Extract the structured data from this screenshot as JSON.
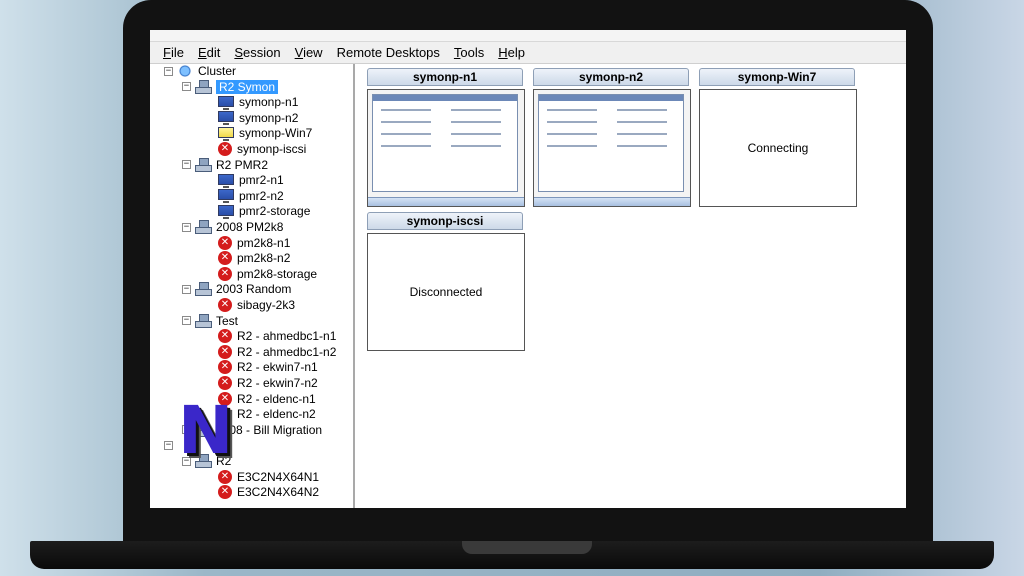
{
  "menu": [
    {
      "label": "File",
      "accel": "F"
    },
    {
      "label": "Edit",
      "accel": "E"
    },
    {
      "label": "Session",
      "accel": "S"
    },
    {
      "label": "View",
      "accel": "V"
    },
    {
      "label": "Remote Desktops",
      "accel": ""
    },
    {
      "label": "Tools",
      "accel": "T"
    },
    {
      "label": "Help",
      "accel": "H"
    }
  ],
  "tree": {
    "root": "Cluster",
    "groups": [
      {
        "label": "R2 Symon",
        "selected": true,
        "items": [
          {
            "label": "symonp-n1",
            "icon": "monitor-icon"
          },
          {
            "label": "symonp-n2",
            "icon": "monitor-icon"
          },
          {
            "label": "symonp-Win7",
            "icon": "monitor-yellow-icon"
          },
          {
            "label": "symonp-iscsi",
            "icon": "error-icon"
          }
        ]
      },
      {
        "label": "R2 PMR2",
        "items": [
          {
            "label": "pmr2-n1",
            "icon": "monitor-icon"
          },
          {
            "label": "pmr2-n2",
            "icon": "monitor-icon"
          },
          {
            "label": "pmr2-storage",
            "icon": "monitor-icon"
          }
        ]
      },
      {
        "label": "2008 PM2k8",
        "items": [
          {
            "label": "pm2k8-n1",
            "icon": "error-icon"
          },
          {
            "label": "pm2k8-n2",
            "icon": "error-icon"
          },
          {
            "label": "pm2k8-storage",
            "icon": "error-icon"
          }
        ]
      },
      {
        "label": "2003 Random",
        "items": [
          {
            "label": "sibagy-2k3",
            "icon": "error-icon"
          }
        ]
      },
      {
        "label": "Test",
        "items": [
          {
            "label": "R2 - ahmedbc1-n1",
            "icon": "error-icon"
          },
          {
            "label": "R2 - ahmedbc1-n2",
            "icon": "error-icon"
          },
          {
            "label": "R2 - ekwin7-n1",
            "icon": "error-icon"
          },
          {
            "label": "R2 - ekwin7-n2",
            "icon": "error-icon"
          },
          {
            "label": "R2 - eldenc-n1",
            "icon": "error-icon"
          },
          {
            "label": "R2 - eldenc-n2",
            "icon": "error-icon"
          }
        ]
      },
      {
        "label": "2008 - Bill Migration",
        "items": []
      },
      {
        "label": "R2",
        "items": [
          {
            "label": "E3C2N4X64N1",
            "icon": "error-icon"
          },
          {
            "label": "E3C2N4X64N2",
            "icon": "error-icon"
          }
        ]
      }
    ]
  },
  "tiles": [
    {
      "name": "symonp-n1",
      "status": "",
      "kind": "screenshot"
    },
    {
      "name": "symonp-n2",
      "status": "",
      "kind": "screenshot"
    },
    {
      "name": "symonp-Win7",
      "status": "Connecting",
      "kind": "text"
    },
    {
      "name": "symonp-iscsi",
      "status": "Disconnected",
      "kind": "text"
    }
  ],
  "overlay_badge": "N",
  "colors": {
    "selection": "#3399ff",
    "error": "#d41c1c",
    "badge": "#3a27c9"
  }
}
